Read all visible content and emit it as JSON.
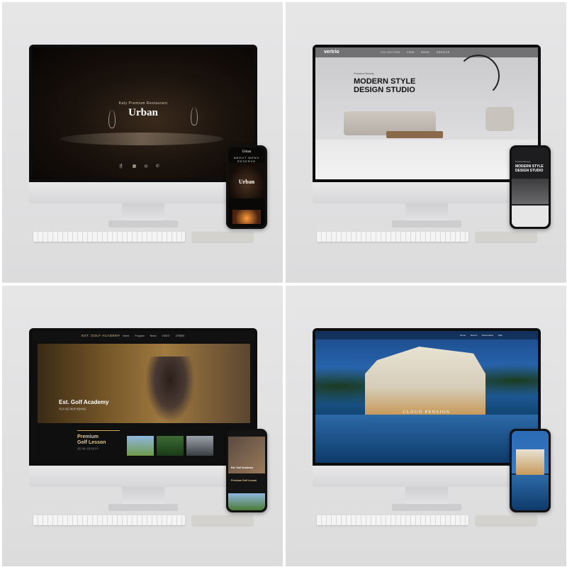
{
  "mockups": [
    {
      "site": "urban",
      "desktop": {
        "subtitle": "Katy Premium Restaurant",
        "brand": "Urban",
        "icons": [
          "fork-knife-icon",
          "calendar-icon",
          "camera-icon",
          "phone-icon"
        ]
      },
      "mobile": {
        "logo": "Urban",
        "nav": "ABOUT  MENU  RESERVE  GALLERY",
        "brand": "Urban"
      }
    },
    {
      "site": "vertrio",
      "desktop": {
        "logo": "vertrio",
        "menu": "COLLECTION VIEW BOOK SERVICE",
        "small": "Practical Beauty",
        "title_line1": "MODERN STYLE",
        "title_line2": "DESIGN STUDIO"
      },
      "mobile": {
        "small": "Practical Beauty",
        "title_line1": "MODERN STYLE",
        "title_line2": "DESIGN STUDIO"
      }
    },
    {
      "site": "golf",
      "desktop": {
        "logo": "EST. GOLF ACADEMY",
        "menu": "Home Program News VIDEO 고객센터",
        "title": "Est. Golf Academy",
        "desc": "최고의 골프 레슨을 경험하세요",
        "lesson_line1": "Premium",
        "lesson_line2": "Golf Lesson",
        "lesson_sub": "골프 레슨 신청 바로가기"
      },
      "mobile": {
        "title": "Est. Golf Academy",
        "lesson": "Premium Golf Lesson"
      }
    },
    {
      "site": "cloud-pension",
      "desktop": {
        "menu": "Home Rooms Reservation Map",
        "title": "CLOUD PENSION"
      }
    }
  ]
}
